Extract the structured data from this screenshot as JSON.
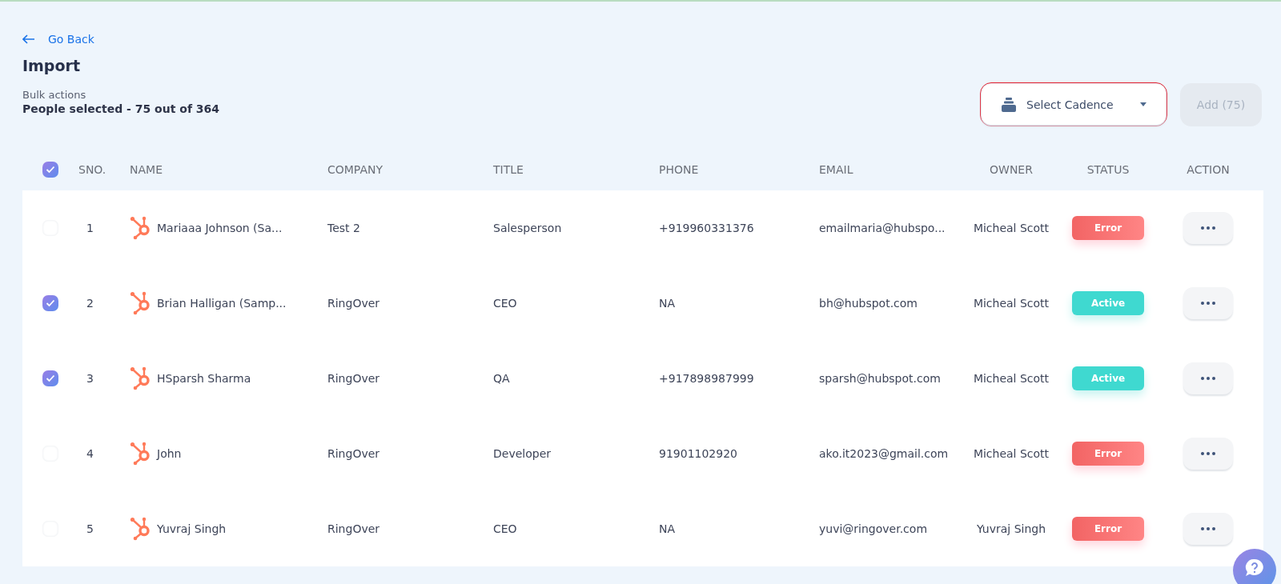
{
  "back_link": {
    "label": "Go Back"
  },
  "page_title": "Import",
  "bulk": {
    "label": "Bulk actions",
    "summary": "People selected - 75 out of 364"
  },
  "cadence_select": {
    "placeholder": "Select Cadence"
  },
  "add_button": {
    "label": "Add (75)",
    "disabled": true
  },
  "table": {
    "select_all_checked": true,
    "columns": [
      "SNO.",
      "NAME",
      "COMPANY",
      "TITLE",
      "PHONE",
      "EMAIL",
      "OWNER",
      "STATUS",
      "ACTION"
    ],
    "rows": [
      {
        "checked": false,
        "sno": "1",
        "name": "Mariaaa Johnson (Sa...",
        "company": "Test 2",
        "title": "Salesperson",
        "phone": "+919960331376",
        "email": "emailmaria@hubspo...",
        "owner": "Micheal Scott",
        "status": {
          "label": "Error",
          "kind": "error"
        }
      },
      {
        "checked": true,
        "sno": "2",
        "name": "Brian Halligan (Samp...",
        "company": "RingOver",
        "title": "CEO",
        "phone": "NA",
        "email": "bh@hubspot.com",
        "owner": "Micheal Scott",
        "status": {
          "label": "Active",
          "kind": "active"
        }
      },
      {
        "checked": true,
        "sno": "3",
        "name": "HSparsh Sharma",
        "company": "RingOver",
        "title": "QA",
        "phone": "+917898987999",
        "email": "sparsh@hubspot.com",
        "owner": "Micheal Scott",
        "status": {
          "label": "Active",
          "kind": "active"
        }
      },
      {
        "checked": false,
        "sno": "4",
        "name": "John",
        "company": "RingOver",
        "title": "Developer",
        "phone": "91901102920",
        "email": "ako.it2023@gmail.com",
        "owner": "Micheal Scott",
        "status": {
          "label": "Error",
          "kind": "error"
        }
      },
      {
        "checked": false,
        "sno": "5",
        "name": "Yuvraj Singh",
        "company": "RingOver",
        "title": "CEO",
        "phone": "NA",
        "email": "yuvi@ringover.com",
        "owner": "Yuvraj Singh",
        "status": {
          "label": "Error",
          "kind": "error"
        }
      }
    ]
  }
}
